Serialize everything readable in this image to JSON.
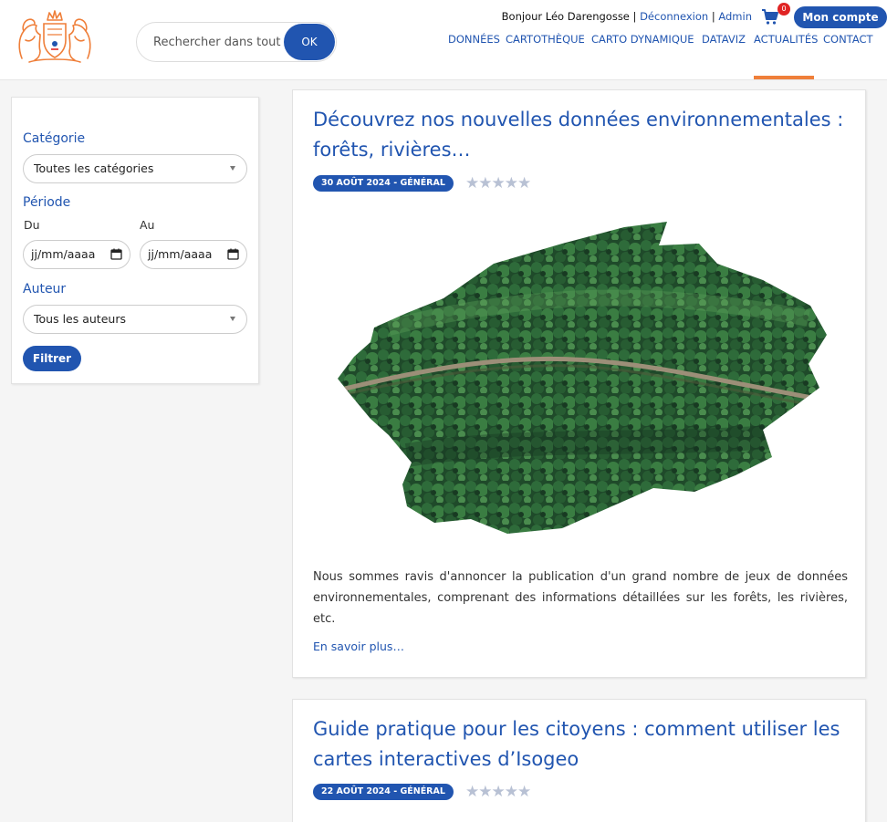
{
  "header": {
    "search_placeholder": "Rechercher dans tout le site",
    "search_button": "OK",
    "greeting": "Bonjour Léo Darengosse",
    "separator": "|",
    "logout": "Déconnexion",
    "admin": "Admin",
    "cart_count": "0",
    "account_button": "Mon compte"
  },
  "nav": {
    "items": [
      "DONNÉES",
      "CARTOTHÈQUE",
      "CARTO DYNAMIQUE",
      "DATAVIZ",
      "ACTUALITÉS",
      "CONTACT"
    ],
    "active": "ACTUALITÉS"
  },
  "sidebar": {
    "category_label": "Catégorie",
    "category_value": "Toutes les catégories",
    "period_label": "Période",
    "from_label": "Du",
    "to_label": "Au",
    "date_placeholder": "jj/mm/aaaa",
    "author_label": "Auteur",
    "author_value": "Tous les auteurs",
    "filter_button": "Filtrer"
  },
  "articles": [
    {
      "title": "Découvrez nos nouvelles données environnementales : forêts, rivières…",
      "meta": "30 AOÛT 2024 - GÉNÉRAL",
      "rating": "★★★★★",
      "excerpt": "Nous sommes ravis d'annoncer la publication d'un grand nombre de jeux de données environnementales, comprenant des informations détaillées sur les forêts, les rivières, etc.",
      "more": "En savoir plus…"
    },
    {
      "title": "Guide pratique pour les citoyens : comment utiliser les cartes interactives d’Isogeo",
      "meta": "22 AOÛT 2024 - GÉNÉRAL",
      "rating": "★★★★★"
    }
  ],
  "colors": {
    "brand_blue": "#2155b0",
    "accent_orange": "#ef7f3a",
    "badge_red": "#e02424"
  }
}
